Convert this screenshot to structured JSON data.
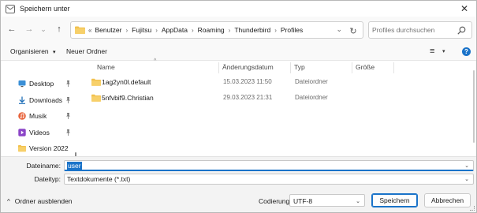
{
  "window": {
    "title": "Speichern unter",
    "close_glyph": "✕"
  },
  "navigation": {
    "back_glyph": "←",
    "forward_glyph": "→",
    "history_glyph": "⌄",
    "up_glyph": "↑",
    "address": {
      "lead": "«",
      "crumbs": [
        "Benutzer",
        "Fujitsu",
        "AppData",
        "Roaming",
        "Thunderbird",
        "Profiles"
      ],
      "separator": "›",
      "dropdown_glyph": "⌄",
      "refresh_glyph": "↻"
    },
    "search": {
      "placeholder": "Profiles durchsuchen"
    }
  },
  "commandbar": {
    "organize_label": "Organisieren",
    "organize_caret": "▾",
    "new_folder_label": "Neuer Ordner",
    "view_glyph": "≡",
    "view_caret": "▾",
    "help_glyph": "?"
  },
  "sidebar": {
    "items": [
      {
        "label": "Desktop",
        "icon": "desktop-icon",
        "pinned": true
      },
      {
        "label": "Downloads",
        "icon": "download-icon",
        "pinned": true
      },
      {
        "label": "Musik",
        "icon": "music-icon",
        "pinned": true
      },
      {
        "label": "Videos",
        "icon": "video-icon",
        "pinned": true
      },
      {
        "label": "Version 2022",
        "icon": "folder-icon",
        "pinned": false
      }
    ],
    "pin_glyph": "📌"
  },
  "filelist": {
    "columns": [
      "Name",
      "Änderungsdatum",
      "Typ",
      "Größe"
    ],
    "sort_glyph": "^",
    "rows": [
      {
        "name": "1ag2yn0l.default",
        "date": "15.03.2023 11:50",
        "type": "Dateiordner",
        "size": ""
      },
      {
        "name": "5nfvbif9.Christian",
        "date": "29.03.2023 21:31",
        "type": "Dateiordner",
        "size": ""
      }
    ]
  },
  "fields": {
    "filename_label": "Dateiname:",
    "filename_value": "user",
    "filetype_label": "Dateityp:",
    "filetype_value": "Textdokumente (*.txt)",
    "dropdown_glyph": "⌄"
  },
  "footer": {
    "toggle_folders_label": "Ordner ausblenden",
    "toggle_caret": "^",
    "encoding_label": "Codierung:",
    "encoding_value": "UTF-8",
    "save_label": "Speichern",
    "cancel_label": "Abbrechen"
  },
  "colors": {
    "accent": "#1a73c9",
    "folder": "#f2c14e",
    "window_bg": "#f3f3f3"
  }
}
